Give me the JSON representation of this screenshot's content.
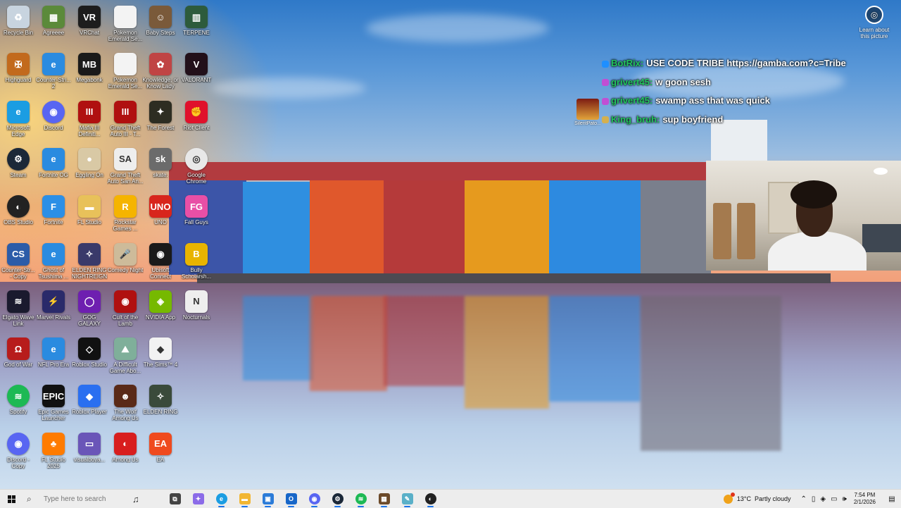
{
  "desktop": {
    "icons": [
      {
        "label": "Recycle Bin",
        "icon": "recycle-bin-icon",
        "color": "#c8d4df",
        "glyph": "♻"
      },
      {
        "label": "Agreeee",
        "icon": "minecraft-avatar-icon",
        "color": "#5b8a3a",
        "glyph": "▦"
      },
      {
        "label": "VRChat",
        "icon": "vrchat-icon",
        "color": "#1d1d1d",
        "glyph": "VR"
      },
      {
        "label": "Pokemon Emerald Se...",
        "icon": "file-icon",
        "color": "#f3f3f3",
        "glyph": ""
      },
      {
        "label": "Baby Steps",
        "icon": "baby-steps-icon",
        "color": "#7a5a3a",
        "glyph": "☺"
      },
      {
        "label": "TERPENE",
        "icon": "terpene-icon",
        "color": "#2d5b3c",
        "glyph": "▥"
      },
      {
        "label": "Highguard",
        "icon": "highguard-icon",
        "color": "#c26a1d",
        "glyph": "✠"
      },
      {
        "label": "Counter-Stri... 2",
        "icon": "internet-explorer-icon",
        "color": "#2a8be0",
        "glyph": "e"
      },
      {
        "label": "Megabonk",
        "icon": "megabonk-icon",
        "color": "#1a1a1a",
        "glyph": "MB"
      },
      {
        "label": "Pokemon Emerald Se...",
        "icon": "file-icon",
        "color": "#f3f3f3",
        "glyph": ""
      },
      {
        "label": "Knowledge, or Know Lady",
        "icon": "knowledge-icon",
        "color": "#c04444",
        "glyph": "✿"
      },
      {
        "label": "VALORANT",
        "icon": "valorant-icon",
        "color": "#22101a",
        "glyph": "V"
      },
      {
        "label": "Microsoft Edge",
        "icon": "edge-icon",
        "color": "#1b9de2",
        "glyph": "e"
      },
      {
        "label": "Discord",
        "icon": "discord-icon",
        "color": "#5865f2",
        "glyph": "◉"
      },
      {
        "label": "Mafia III Definiti...",
        "icon": "mafia-icon",
        "color": "#b01010",
        "glyph": "III"
      },
      {
        "label": "Grand Theft Auto III - T...",
        "icon": "gta3-icon",
        "color": "#b01010",
        "glyph": "III"
      },
      {
        "label": "The Forest",
        "icon": "the-forest-icon",
        "color": "#2d2d22",
        "glyph": "✦"
      },
      {
        "label": "Riot Client",
        "icon": "riot-client-icon",
        "color": "#e0112b",
        "glyph": "✊"
      },
      {
        "label": "Steam",
        "icon": "steam-icon",
        "color": "#1b2838",
        "glyph": "⚙"
      },
      {
        "label": "Fortnite OG",
        "icon": "internet-explorer-icon",
        "color": "#2a8be0",
        "glyph": "e"
      },
      {
        "label": "Eggling On",
        "icon": "egg-icon",
        "color": "#d9c9a5",
        "glyph": "●"
      },
      {
        "label": "Grand Theft Auto San An...",
        "icon": "gta-sa-icon",
        "color": "#eeeeee",
        "glyph": "SA"
      },
      {
        "label": "skate.",
        "icon": "skate-icon",
        "color": "#6b6b6b",
        "glyph": "sk"
      },
      {
        "label": "Google Chrome",
        "icon": "chrome-icon",
        "color": "#e8e8e8",
        "glyph": "◎"
      },
      {
        "label": "OBS Studio",
        "icon": "obs-icon",
        "color": "#222222",
        "glyph": "◐"
      },
      {
        "label": "Fortnite",
        "icon": "fortnite-icon",
        "color": "#2c8fe6",
        "glyph": "F"
      },
      {
        "label": "FL Studio",
        "icon": "folder-icon",
        "color": "#e8c15a",
        "glyph": "▬"
      },
      {
        "label": "Rockstar Games ...",
        "icon": "rockstar-icon",
        "color": "#f5b400",
        "glyph": "R"
      },
      {
        "label": "UNO",
        "icon": "uno-icon",
        "color": "#d8251c",
        "glyph": "UNO"
      },
      {
        "label": "Fall Guys",
        "icon": "fall-guys-icon",
        "color": "#e84fa6",
        "glyph": "FG"
      },
      {
        "label": "Counter-Str... - Copy",
        "icon": "counter-strike-icon",
        "color": "#2c5ca8",
        "glyph": "CS"
      },
      {
        "label": "Ghost of Tsushima ...",
        "icon": "internet-explorer-icon",
        "color": "#2a8be0",
        "glyph": "e"
      },
      {
        "label": "ELDEN RING NIGHTREIGN",
        "icon": "nightreign-icon",
        "color": "#3a3a6a",
        "glyph": "✧"
      },
      {
        "label": "Comedy Night",
        "icon": "comedy-night-icon",
        "color": "#cdbb9a",
        "glyph": "🎤"
      },
      {
        "label": "Ubisoft Connect",
        "icon": "ubisoft-icon",
        "color": "#1a1a1a",
        "glyph": "◉"
      },
      {
        "label": "Bully Scholarsh...",
        "icon": "bully-icon",
        "color": "#e8b400",
        "glyph": "B"
      },
      {
        "label": "Elgato Wave Link",
        "icon": "elgato-icon",
        "color": "#1a1a2e",
        "glyph": "≋"
      },
      {
        "label": "Marvel Rivals",
        "icon": "marvel-rivals-icon",
        "color": "#2a2a6a",
        "glyph": "⚡"
      },
      {
        "label": "GOG GALAXY",
        "icon": "gog-icon",
        "color": "#6e1fb0",
        "glyph": "◯"
      },
      {
        "label": "Cult of the Lamb",
        "icon": "cult-of-the-lamb-icon",
        "color": "#b01010",
        "glyph": "◉"
      },
      {
        "label": "NVIDIA App",
        "icon": "nvidia-icon",
        "color": "#76b900",
        "glyph": "◈"
      },
      {
        "label": "Nocturnals",
        "icon": "nocturnals-icon",
        "color": "#eeeeee",
        "glyph": "N"
      },
      {
        "label": "God of War",
        "icon": "god-of-war-icon",
        "color": "#b71c1c",
        "glyph": "Ω"
      },
      {
        "label": "NFL Pro Era",
        "icon": "internet-explorer-icon",
        "color": "#2a8be0",
        "glyph": "e"
      },
      {
        "label": "Roblox Studio",
        "icon": "roblox-studio-icon",
        "color": "#111111",
        "glyph": "◇"
      },
      {
        "label": "A Difficult Game Abo...",
        "icon": "difficult-game-icon",
        "color": "#7faf9a",
        "glyph": "⛰"
      },
      {
        "label": "The Sims™ 4",
        "icon": "sims-icon",
        "color": "#f2f2f2",
        "glyph": "◆"
      },
      {
        "label": "Spotify",
        "icon": "spotify-icon",
        "color": "#1db954",
        "glyph": "≋"
      },
      {
        "label": "Epic Games Launcher",
        "icon": "epic-games-icon",
        "color": "#111111",
        "glyph": "EPIC"
      },
      {
        "label": "Roblox Player",
        "icon": "roblox-icon",
        "color": "#2a6ff0",
        "glyph": "◆"
      },
      {
        "label": "The Wolf Among Us",
        "icon": "wolf-among-us-icon",
        "color": "#5a2a18",
        "glyph": "☻"
      },
      {
        "label": "ELDEN RING",
        "icon": "elden-ring-icon",
        "color": "#3a4a3a",
        "glyph": "✧"
      },
      {
        "label": "Discord - Copy",
        "icon": "discord-icon",
        "color": "#5865f2",
        "glyph": "◉"
      },
      {
        "label": "FL Studio 2025",
        "icon": "fl-studio-icon",
        "color": "#ff7b00",
        "glyph": "♣"
      },
      {
        "label": "visualboya...",
        "icon": "visualboy-icon",
        "color": "#6a55b8",
        "glyph": "▭"
      },
      {
        "label": "Among Us",
        "icon": "among-us-icon",
        "color": "#d81e1e",
        "glyph": "◐"
      },
      {
        "label": "EA",
        "icon": "ea-icon",
        "color": "#ef4a1e",
        "glyph": "EA"
      }
    ],
    "learn": {
      "label": "Learn about this picture",
      "icon": "camera-icon"
    },
    "silent": {
      "label": "SilentPato..."
    }
  },
  "chat": {
    "messages": [
      {
        "user": "BotRix:",
        "text": "USE CODE TRIBE https://gamba.com?c=Tribe",
        "user_color": "#22c55e",
        "badge": "#1f8fff"
      },
      {
        "user": "grivert45:",
        "text": "w goon sesh",
        "user_color": "#22c55e",
        "badge": "#c04fd4"
      },
      {
        "user": "grivert45:",
        "text": "swamp ass that was quick",
        "user_color": "#22c55e",
        "badge": "#c04fd4"
      },
      {
        "user": "King_bruh:",
        "text": "sup boyfriend",
        "user_color": "#22c55e",
        "badge": "#d4b04f"
      }
    ]
  },
  "taskbar": {
    "search_placeholder": "Type here to search",
    "apps": [
      {
        "name": "task-view",
        "icon": "task-view-icon",
        "color": "#444444",
        "glyph": "⧉"
      },
      {
        "name": "copilot",
        "icon": "copilot-icon",
        "color": "#8b6be8",
        "glyph": "✦"
      },
      {
        "name": "edge",
        "icon": "edge-icon",
        "color": "#1b9de2",
        "glyph": "e"
      },
      {
        "name": "file-explorer",
        "icon": "folder-icon",
        "color": "#f2b632",
        "glyph": "▬"
      },
      {
        "name": "store",
        "icon": "store-icon",
        "color": "#2b7bd8",
        "glyph": "▣"
      },
      {
        "name": "outlook",
        "icon": "outlook-icon",
        "color": "#1766c8",
        "glyph": "O"
      },
      {
        "name": "discord",
        "icon": "discord-icon",
        "color": "#5865f2",
        "glyph": "◉"
      },
      {
        "name": "steam",
        "icon": "steam-icon",
        "color": "#1b2838",
        "glyph": "⚙"
      },
      {
        "name": "spotify",
        "icon": "spotify-icon",
        "color": "#1db954",
        "glyph": "≋"
      },
      {
        "name": "minecraft",
        "icon": "minecraft-icon",
        "color": "#6c4a2a",
        "glyph": "▦"
      },
      {
        "name": "editor",
        "icon": "notepad-icon",
        "color": "#5ab0c8",
        "glyph": "✎"
      },
      {
        "name": "obs",
        "icon": "obs-icon",
        "color": "#222222",
        "glyph": "◐"
      }
    ],
    "weather": {
      "temp": "13°C",
      "condition": "Partly cloudy"
    },
    "clock": {
      "time": "7:54 PM",
      "date": "2/1/2026"
    }
  }
}
